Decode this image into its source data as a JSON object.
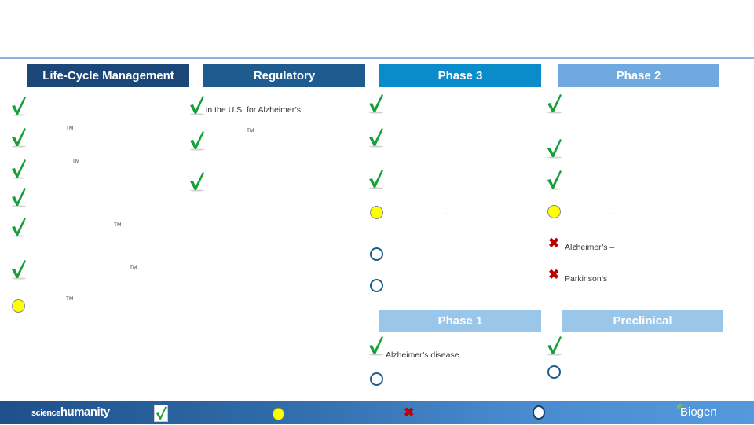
{
  "page": {
    "title": ""
  },
  "headers": {
    "life_cycle": "Life-Cycle Management",
    "regulatory": "Regulatory",
    "phase3": "Phase 3",
    "phase2": "Phase 2",
    "phase1": "Phase 1",
    "preclinical": "Preclinical"
  },
  "life_cycle": {
    "items": [
      {
        "status": "check",
        "text": "",
        "tm": ""
      },
      {
        "status": "check",
        "text": "",
        "tm": "TM"
      },
      {
        "status": "check",
        "text": "",
        "tm": "TM"
      },
      {
        "status": "check",
        "text": "",
        "tm": ""
      },
      {
        "status": "check",
        "text": "",
        "tm": "TM"
      },
      {
        "status": "check",
        "text": "",
        "tm": "TM"
      },
      {
        "status": "in-progress",
        "text": "",
        "tm": "TM"
      }
    ]
  },
  "regulatory": {
    "items": [
      {
        "status": "check",
        "text": "in the U.S. for Alzheimer’s",
        "tm": ""
      },
      {
        "status": "check",
        "text": "",
        "tm": "TM"
      },
      {
        "status": "check",
        "text": "",
        "tm": ""
      }
    ]
  },
  "phase3": {
    "items": [
      {
        "status": "check",
        "text": ""
      },
      {
        "status": "check",
        "text": ""
      },
      {
        "status": "check",
        "text": ""
      },
      {
        "status": "in-progress",
        "text": "–"
      },
      {
        "status": "not-started",
        "text": ""
      },
      {
        "status": "not-started",
        "text": ""
      }
    ]
  },
  "phase2": {
    "items": [
      {
        "status": "check",
        "text": ""
      },
      {
        "status": "check",
        "text": ""
      },
      {
        "status": "check",
        "text": ""
      },
      {
        "status": "in-progress",
        "text": "–"
      },
      {
        "status": "failed",
        "text": "Alzheimer’s –"
      },
      {
        "status": "failed",
        "text": "Parkinson’s"
      }
    ]
  },
  "phase1": {
    "items": [
      {
        "status": "check",
        "text": "Alzheimer’s disease"
      },
      {
        "status": "not-started",
        "text": ""
      }
    ]
  },
  "preclinical": {
    "items": [
      {
        "status": "check",
        "text": ""
      },
      {
        "status": "not-started",
        "text": ""
      }
    ]
  },
  "footer": {
    "logo_science": "science",
    "logo_humanity": "humanity",
    "brand": "Biogen",
    "legend": [
      "check-icon",
      "yellow-dot-icon",
      "red-x-icon",
      "open-circle-icon"
    ]
  },
  "colors": {
    "lcm_header": "#1a4778",
    "regulatory_header": "#1e5b8f",
    "phase3_header": "#0a8bca",
    "phase2_header": "#6fa9e0",
    "phase1_header": "#9ac6ea",
    "check_green": "#1aa03c",
    "failed_red": "#c00000",
    "in_progress_yellow": "#ffff00"
  }
}
